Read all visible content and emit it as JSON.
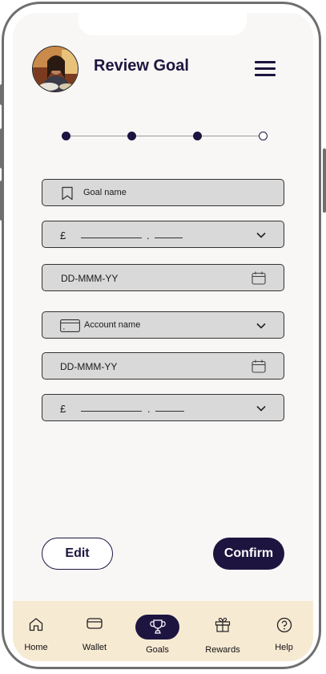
{
  "header": {
    "title": "Review Goal"
  },
  "stepper": {
    "steps_total": 4,
    "steps_completed": 3
  },
  "form": {
    "goal_name_placeholder": "Goal name",
    "amount_currency": "£",
    "amount_separator": ".",
    "start_date_placeholder": "DD-MMM-YY",
    "account_name_placeholder": "Account name",
    "end_date_placeholder": "DD-MMM-YY",
    "amount2_currency": "£",
    "amount2_separator": "."
  },
  "actions": {
    "edit_label": "Edit",
    "confirm_label": "Confirm"
  },
  "tabbar": {
    "active": "Goals",
    "items": [
      {
        "label": "Home",
        "icon": "home-icon"
      },
      {
        "label": "Wallet",
        "icon": "wallet-icon"
      },
      {
        "label": "Goals",
        "icon": "trophy-icon"
      },
      {
        "label": "Rewards",
        "icon": "gift-icon"
      },
      {
        "label": "Help",
        "icon": "help-icon"
      }
    ]
  },
  "colors": {
    "primary": "#1d1540",
    "screen_bg": "#f9f7f5",
    "field_bg": "#d9d9d9",
    "tabbar_bg": "#f7ead3"
  }
}
